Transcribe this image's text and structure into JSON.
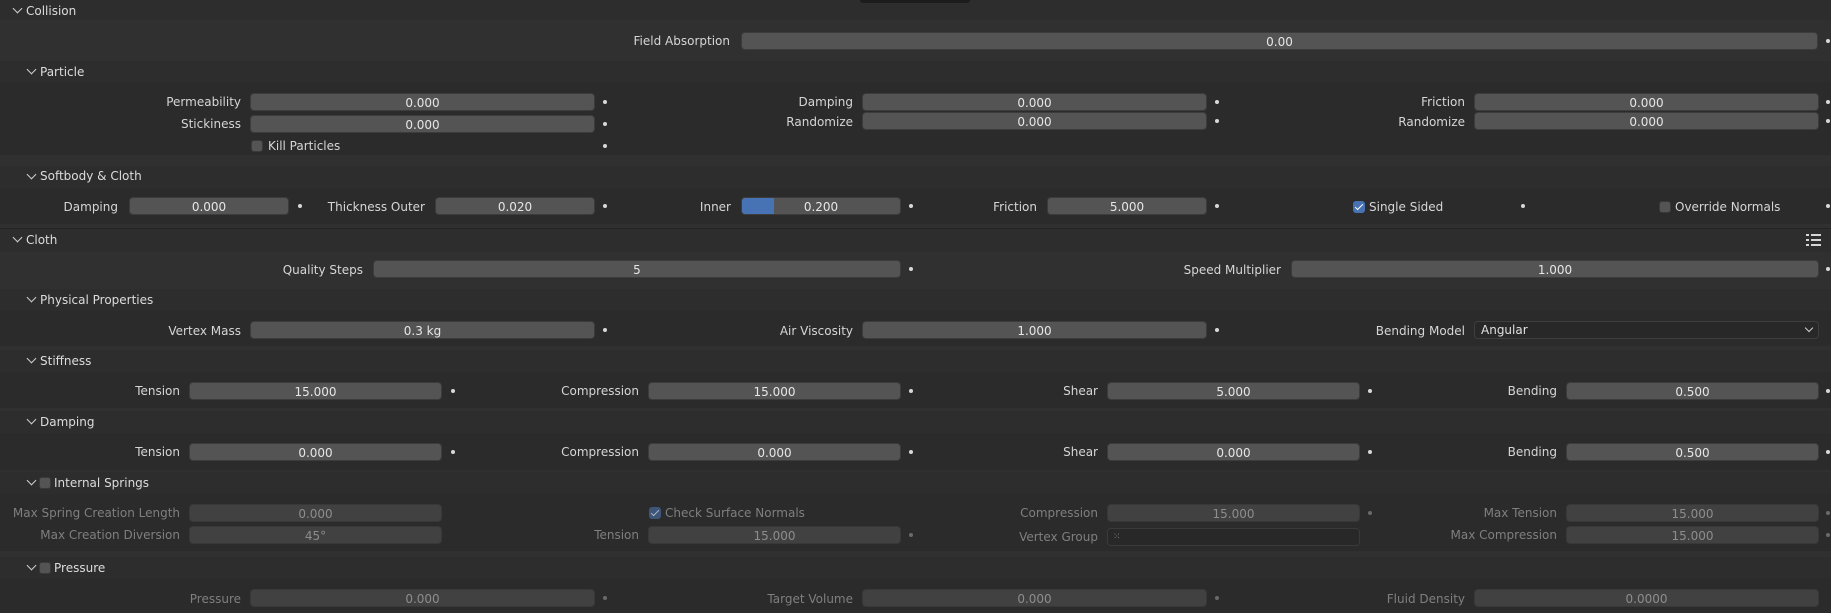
{
  "collision": {
    "title": "Collision",
    "field_absorption": {
      "label": "Field Absorption",
      "value": "0.00"
    },
    "particle": {
      "title": "Particle",
      "permeability": {
        "label": "Permeability",
        "value": "0.000"
      },
      "stickiness": {
        "label": "Stickiness",
        "value": "0.000"
      },
      "kill_particles": {
        "label": "Kill Particles",
        "checked": false
      },
      "damping": {
        "label": "Damping",
        "value": "0.000"
      },
      "damping_randomize": {
        "label": "Randomize",
        "value": "0.000"
      },
      "friction": {
        "label": "Friction",
        "value": "0.000"
      },
      "friction_randomize": {
        "label": "Randomize",
        "value": "0.000"
      }
    },
    "softbody_cloth": {
      "title": "Softbody & Cloth",
      "damping": {
        "label": "Damping",
        "value": "0.000"
      },
      "thickness_outer": {
        "label": "Thickness Outer",
        "value": "0.020"
      },
      "inner": {
        "label": "Inner",
        "value": "0.200",
        "fraction": 0.2
      },
      "friction": {
        "label": "Friction",
        "value": "5.000"
      },
      "single_sided": {
        "label": "Single Sided",
        "checked": true
      },
      "override_normals": {
        "label": "Override Normals",
        "checked": false
      }
    }
  },
  "cloth": {
    "title": "Cloth",
    "list_icon": "list-icon",
    "quality_steps": {
      "label": "Quality Steps",
      "value": "5"
    },
    "speed_multiplier": {
      "label": "Speed Multiplier",
      "value": "1.000"
    },
    "physical": {
      "title": "Physical Properties",
      "vertex_mass": {
        "label": "Vertex Mass",
        "value": "0.3 kg"
      },
      "air_viscosity": {
        "label": "Air Viscosity",
        "value": "1.000"
      },
      "bending_model": {
        "label": "Bending Model",
        "value": "Angular"
      }
    },
    "stiffness": {
      "title": "Stiffness",
      "tension": {
        "label": "Tension",
        "value": "15.000"
      },
      "compression": {
        "label": "Compression",
        "value": "15.000"
      },
      "shear": {
        "label": "Shear",
        "value": "5.000"
      },
      "bending": {
        "label": "Bending",
        "value": "0.500"
      }
    },
    "damping": {
      "title": "Damping",
      "tension": {
        "label": "Tension",
        "value": "0.000"
      },
      "compression": {
        "label": "Compression",
        "value": "0.000"
      },
      "shear": {
        "label": "Shear",
        "value": "0.000"
      },
      "bending": {
        "label": "Bending",
        "value": "0.500"
      }
    },
    "internal_springs": {
      "title": "Internal Springs",
      "enabled": false,
      "max_spring_creation_length": {
        "label": "Max Spring Creation Length",
        "value": "0.000"
      },
      "max_creation_diversion": {
        "label": "Max Creation Diversion",
        "value": "45°"
      },
      "check_surface_normals": {
        "label": "Check Surface Normals",
        "checked": true
      },
      "tension": {
        "label": "Tension",
        "value": "15.000"
      },
      "compression": {
        "label": "Compression",
        "value": "15.000"
      },
      "vertex_group": {
        "label": "Vertex Group",
        "value": ""
      },
      "max_tension": {
        "label": "Max Tension",
        "value": "15.000"
      },
      "max_compression": {
        "label": "Max Compression",
        "value": "15.000"
      }
    },
    "pressure": {
      "title": "Pressure",
      "enabled": false,
      "pressure": {
        "label": "Pressure",
        "value": "0.000"
      },
      "target_volume": {
        "label": "Target Volume",
        "value": "0.000"
      },
      "fluid_density": {
        "label": "Fluid Density",
        "value": "0.0000"
      }
    }
  }
}
